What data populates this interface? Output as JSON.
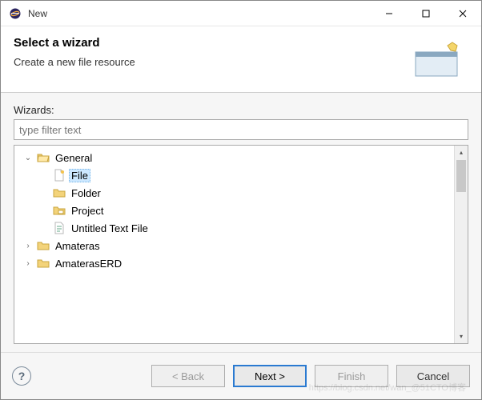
{
  "titlebar": {
    "title": "New"
  },
  "header": {
    "heading": "Select a wizard",
    "sub": "Create a new file resource"
  },
  "body": {
    "wizards_label": "Wizards:",
    "filter_placeholder": "type filter text"
  },
  "tree": {
    "general": {
      "label": "General",
      "expanded": true
    },
    "file": {
      "label": "File",
      "selected": true
    },
    "folder": {
      "label": "Folder"
    },
    "project": {
      "label": "Project"
    },
    "untitled": {
      "label": "Untitled Text File"
    },
    "amateras": {
      "label": "Amateras",
      "expanded": false
    },
    "amateraserd": {
      "label": "AmaterasERD",
      "expanded": false
    }
  },
  "buttons": {
    "back": "< Back",
    "next": "Next >",
    "finish": "Finish",
    "cancel": "Cancel"
  },
  "watermark": "https://blog.csdn.net/wan_@51CTO博客"
}
